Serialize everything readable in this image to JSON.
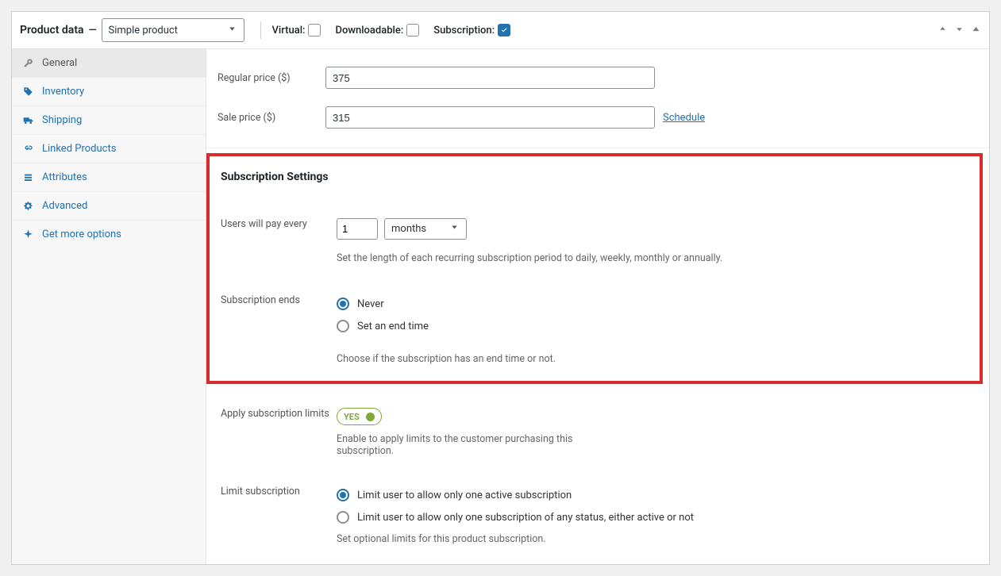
{
  "header": {
    "title": "Product data",
    "dash": "—",
    "product_type": "Simple product",
    "options": {
      "virtual": {
        "label": "Virtual:",
        "checked": false
      },
      "downloadable": {
        "label": "Downloadable:",
        "checked": false
      },
      "subscription": {
        "label": "Subscription:",
        "checked": true
      }
    }
  },
  "tabs": [
    {
      "id": "general",
      "label": "General",
      "icon": "wrench",
      "active": true
    },
    {
      "id": "inventory",
      "label": "Inventory",
      "icon": "tag"
    },
    {
      "id": "shipping",
      "label": "Shipping",
      "icon": "truck"
    },
    {
      "id": "linked",
      "label": "Linked Products",
      "icon": "link"
    },
    {
      "id": "attributes",
      "label": "Attributes",
      "icon": "list"
    },
    {
      "id": "advanced",
      "label": "Advanced",
      "icon": "gear"
    },
    {
      "id": "getmore",
      "label": "Get more options",
      "icon": "spark"
    }
  ],
  "prices": {
    "regular": {
      "label": "Regular price ($)",
      "value": "375"
    },
    "sale": {
      "label": "Sale price ($)",
      "value": "315",
      "schedule": "Schedule"
    }
  },
  "subscription": {
    "title": "Subscription Settings",
    "pay_every": {
      "label": "Users will pay every",
      "number": "1",
      "period": "months",
      "help": "Set the length of each recurring subscription period to daily, weekly, monthly or annually."
    },
    "ends": {
      "label": "Subscription ends",
      "options": {
        "never": "Never",
        "set": "Set an end time"
      },
      "selected": "never",
      "help": "Choose if the subscription has an end time or not."
    }
  },
  "limits": {
    "apply": {
      "label": "Apply subscription limits",
      "toggle": "YES",
      "help": "Enable to apply limits to the customer purchasing this subscription."
    },
    "limit": {
      "label": "Limit subscription",
      "options": {
        "active": "Limit user to allow only one active subscription",
        "any": "Limit user to allow only one subscription of any status, either active or not"
      },
      "selected": "active",
      "help": "Set optional limits for this product subscription."
    }
  }
}
